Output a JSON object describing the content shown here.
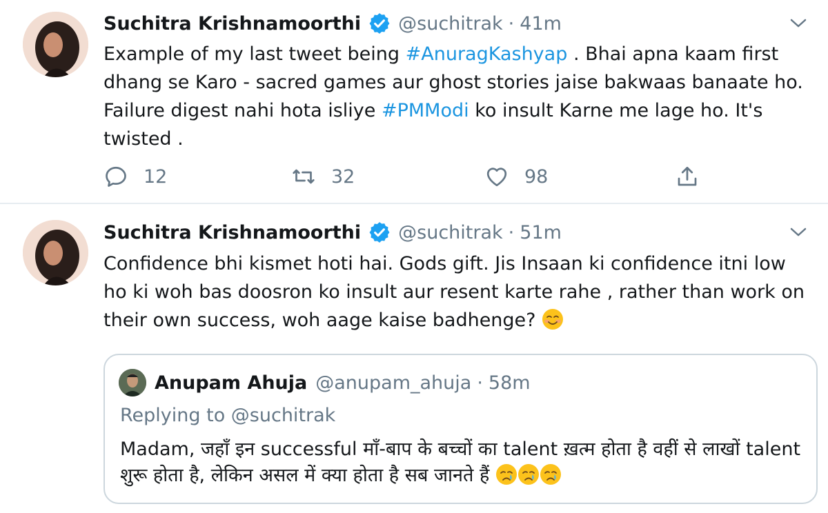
{
  "tweets": [
    {
      "author_name": "Suchitra Krishnamoorthi",
      "handle": "@suchitrak",
      "separator": "·",
      "time": "41m",
      "text_parts": [
        "Example of my last tweet being ",
        "#AnuragKashyap",
        " . Bhai apna kaam first dhang se Karo - sacred games aur ghost stories jaise bakwaas banaate ho. Failure digest nahi hota isliye ",
        "#PMModi",
        " ko insult Karne me lage ho. It's twisted ."
      ],
      "replies": "12",
      "retweets": "32",
      "likes": "98"
    },
    {
      "author_name": "Suchitra Krishnamoorthi",
      "handle": "@suchitrak",
      "separator": "·",
      "time": "51m",
      "text": "Confidence bhi kismet hoti hai. Gods gift. Jis Insaan ki confidence itni low ho ki woh bas doosron ko insult aur  resent karte rahe , rather than work on their own success,  woh aage kaise  badhenge? ",
      "emoji": "smiling-face-emoji",
      "quoted": {
        "author_name": "Anupam Ahuja",
        "handle": "@anupam_ahuja",
        "separator": "·",
        "time": "58m",
        "replying_to": "Replying to @suchitrak",
        "text": "Madam, जहाँ इन successful माँ-बाप के बच्चों का talent ख़त्म होता है वहीं से लाखों talent शुरू होता है, लेकिन असल में क्या होता है सब जानते हैं ",
        "emojis": [
          "crying-face-emoji",
          "crying-face-emoji",
          "crying-face-emoji"
        ]
      }
    }
  ],
  "colors": {
    "link": "#1b95e0",
    "secondary_text": "#657786",
    "primary_text": "#14171a",
    "verified": "#1da1f2",
    "border": "#ccd6dd"
  }
}
